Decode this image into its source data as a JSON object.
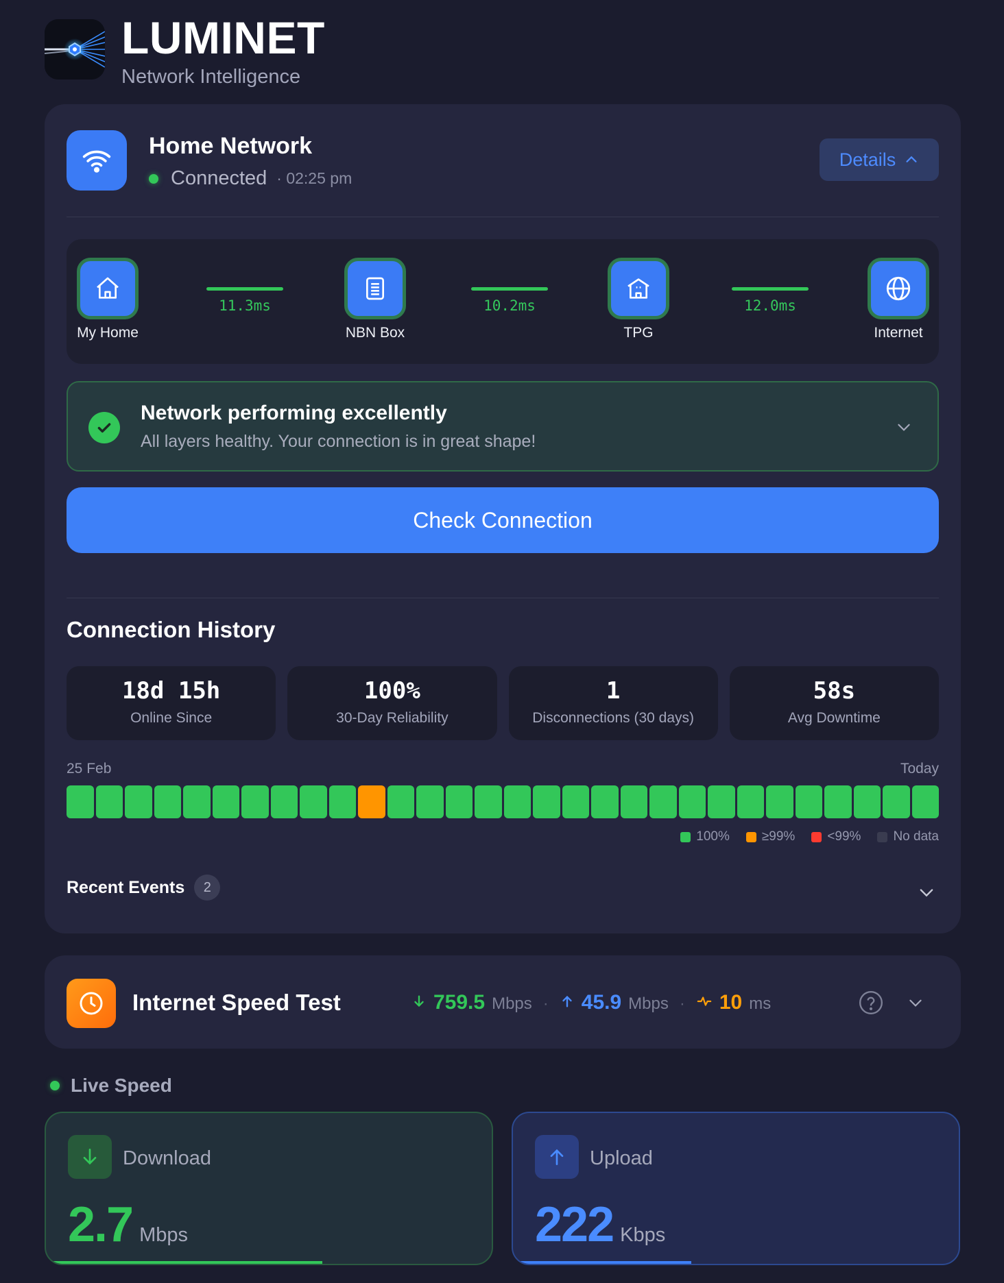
{
  "app": {
    "brand": "LUMINET",
    "tagline": "Network Intelligence"
  },
  "network": {
    "name": "Home Network",
    "status": "Connected",
    "time": "· 02:25 pm",
    "details_label": "Details",
    "nodes": [
      {
        "label": "My Home",
        "icon": "home-icon"
      },
      {
        "label": "NBN Box",
        "icon": "modem-icon"
      },
      {
        "label": "TPG",
        "icon": "isp-building-icon"
      },
      {
        "label": "Internet",
        "icon": "globe-icon"
      }
    ],
    "links": [
      "11.3ms",
      "10.2ms",
      "12.0ms"
    ],
    "banner": {
      "title": "Network performing excellently",
      "subtitle": "All layers healthy. Your connection is in great shape!"
    },
    "check_button": "Check Connection"
  },
  "history": {
    "title": "Connection History",
    "stats": [
      {
        "value": "18d 15h",
        "label": "Online Since"
      },
      {
        "value": "100%",
        "label": "30-Day Reliability"
      },
      {
        "value": "1",
        "label": "Disconnections (30 days)"
      },
      {
        "value": "58s",
        "label": "Avg Downtime"
      }
    ],
    "start_label": "25 Feb",
    "end_label": "Today",
    "days": [
      "100",
      "100",
      "100",
      "100",
      "100",
      "100",
      "100",
      "100",
      "100",
      "100",
      "99",
      "100",
      "100",
      "100",
      "100",
      "100",
      "100",
      "100",
      "100",
      "100",
      "100",
      "100",
      "100",
      "100",
      "100",
      "100",
      "100",
      "100",
      "100",
      "100"
    ],
    "legend": [
      {
        "label": "100%",
        "color": "#33c759"
      },
      {
        "label": "≥99%",
        "color": "#ff9500"
      },
      {
        "label": "<99%",
        "color": "#ff3b30"
      },
      {
        "label": "No data",
        "color": "#3a3c50"
      }
    ],
    "events_label": "Recent Events",
    "events_count": "2"
  },
  "speed_test": {
    "title": "Internet Speed Test",
    "download": {
      "value": "759.5",
      "unit": "Mbps"
    },
    "upload": {
      "value": "45.9",
      "unit": "Mbps"
    },
    "ping": {
      "value": "10",
      "unit": "ms"
    }
  },
  "live": {
    "label": "Live Speed",
    "download": {
      "label": "Download",
      "value": "2.7",
      "unit": "Mbps"
    },
    "upload": {
      "label": "Upload",
      "value": "222",
      "unit": "Kbps"
    }
  },
  "colors": {
    "accent": "#3e80f8",
    "good": "#33c759",
    "warn": "#ff9500",
    "bad": "#ff3b30"
  }
}
